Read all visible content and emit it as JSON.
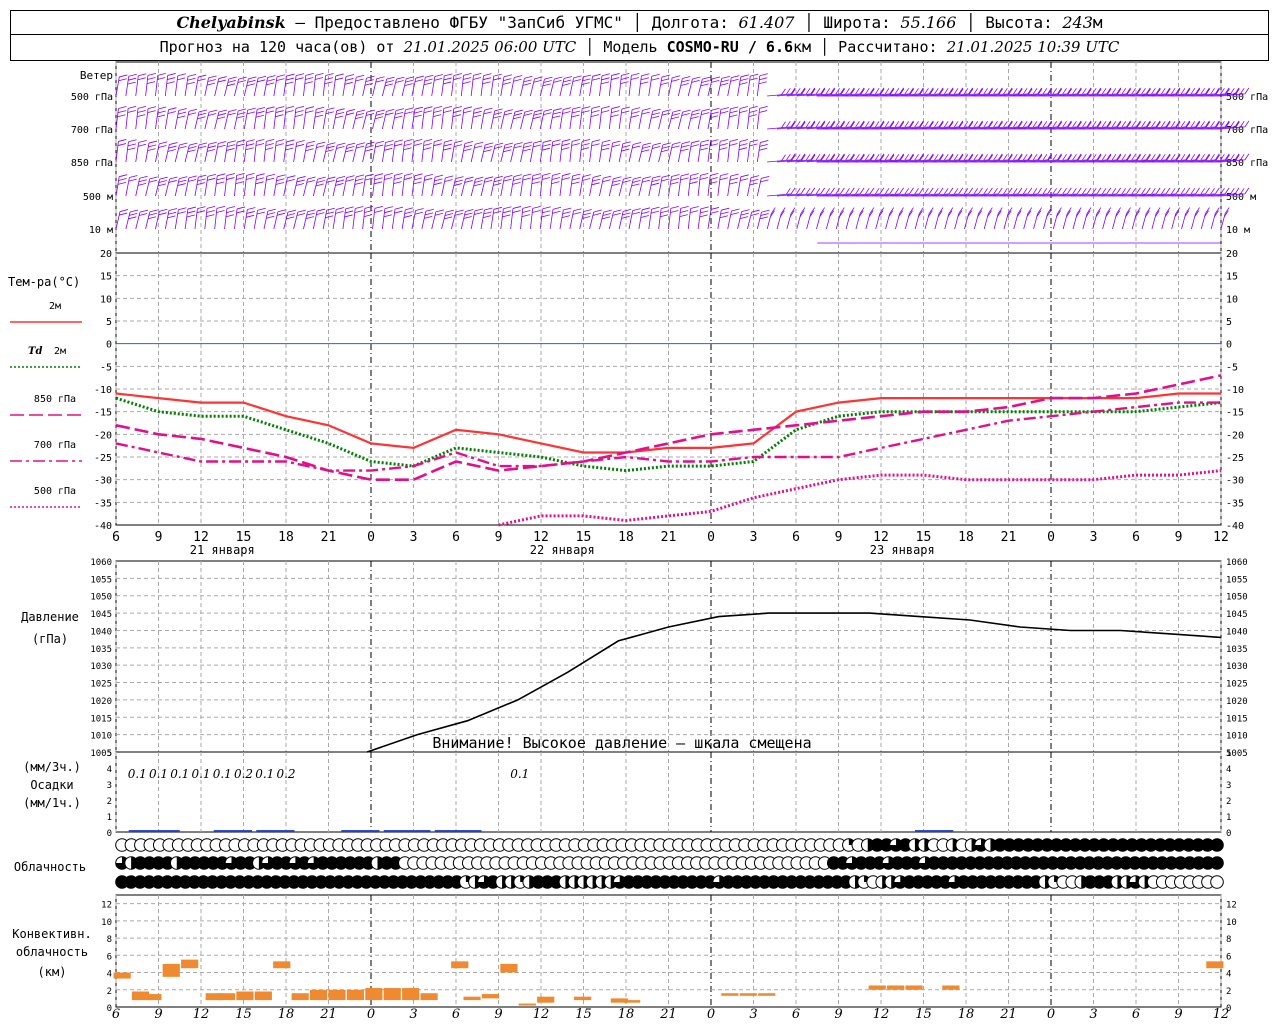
{
  "header": {
    "city": "Chelyabinsk",
    "provider": " – Предоставлено ФГБУ \"ЗапСиб УГМС\" │ Долгота: ",
    "lon": "61.407",
    "lat_label": " │ Широта: ",
    "lat": "55.166",
    "alt_label": " │ Высота: ",
    "alt": "243",
    "alt_unit": "м",
    "fc_label": "Прогноз на 120 часа(ов) от ",
    "fc_time": "21.01.2025 06:00 UTC",
    "model_label": " │ Модель ",
    "model": "COSMO-RU / 6.6",
    "model_unit": "км",
    "calc_label": " │ Рассчитано: ",
    "calc_time": "21.01.2025 10:39 UTC"
  },
  "chart_data": {
    "x_hours": [
      6,
      9,
      12,
      15,
      18,
      21,
      0,
      3,
      6,
      9,
      12,
      15,
      18,
      21,
      0,
      3,
      6,
      9,
      12,
      15,
      18,
      21,
      0,
      3,
      6,
      9,
      12
    ],
    "day_labels": [
      "21 января",
      "22 января",
      "23 января"
    ],
    "wind": {
      "title": "Ветер",
      "levels": [
        "500 гПа",
        "700 гПа",
        "850 гПа",
        "500 м",
        "10 м"
      ],
      "color": "#7f00ff"
    },
    "temperature": {
      "type": "line",
      "title": "Тем-ра(°C)",
      "ylim": [
        -40,
        20
      ],
      "yticks": [
        20,
        15,
        10,
        5,
        0,
        -5,
        -10,
        -15,
        -20,
        -25,
        -30,
        -35,
        -40
      ],
      "legend": [
        {
          "label": "2м",
          "color": "#ff3333",
          "style": "solid"
        },
        {
          "label": "Td",
          "label2": "2м",
          "color": "#008000",
          "style": "dotted"
        },
        {
          "label": "850 гПа",
          "color": "#e0108c",
          "style": "longdash"
        },
        {
          "label": "700 гПа",
          "color": "#e0108c",
          "style": "dashdot"
        },
        {
          "label": "500 гПа",
          "color": "#e0108c",
          "style": "dotted"
        }
      ],
      "series": [
        {
          "name": "2м",
          "values": [
            -11,
            -12,
            -13,
            -13,
            -16,
            -18,
            -22,
            -23,
            -19,
            -20,
            -22,
            -24,
            -24,
            -23,
            -23,
            -22,
            -15,
            -13,
            -12,
            -12,
            -12,
            -12,
            -12,
            -12,
            -12,
            -11,
            -11
          ]
        },
        {
          "name": "Td 2м",
          "values": [
            -12,
            -15,
            -16,
            -16,
            -19,
            -22,
            -26,
            -27,
            -23,
            -24,
            -25,
            -27,
            -28,
            -27,
            -27,
            -26,
            -19,
            -16,
            -15,
            -15,
            -15,
            -15,
            -15,
            -15,
            -15,
            -14,
            -13
          ]
        },
        {
          "name": "850 гПа",
          "values": [
            -18,
            -20,
            -21,
            -23,
            -25,
            -28,
            -30,
            -30,
            -26,
            -28,
            -27,
            -26,
            -24,
            -22,
            -20,
            -19,
            -18,
            -17,
            -16,
            -15,
            -15,
            -14,
            -12,
            -12,
            -11,
            -9,
            -7
          ]
        },
        {
          "name": "700 гПа",
          "values": [
            -22,
            -24,
            -26,
            -26,
            -26,
            -28,
            -28,
            -27,
            -24,
            -27,
            -27,
            -26,
            -25,
            -26,
            -26,
            -25,
            -25,
            -25,
            -23,
            -21,
            -19,
            -17,
            -16,
            -15,
            -14,
            -13,
            -13
          ]
        },
        {
          "name": "500 гПа",
          "values": [
            null,
            null,
            null,
            null,
            null,
            null,
            null,
            null,
            null,
            -40,
            -38,
            -38,
            -39,
            -38,
            -37,
            -34,
            -32,
            -30,
            -29,
            -29,
            -30,
            -30,
            -30,
            -30,
            -29,
            -29,
            -28
          ]
        }
      ]
    },
    "pressure": {
      "type": "line",
      "title": "Давление",
      "unit": "(гПа)",
      "ylim": [
        1005,
        1060
      ],
      "yticks": [
        1060,
        1055,
        1050,
        1045,
        1040,
        1035,
        1030,
        1025,
        1020,
        1015,
        1010,
        1005
      ],
      "warning": "Внимание! Высокое давление – шкала смещена",
      "color": "#000000",
      "values": [
        null,
        null,
        null,
        null,
        null,
        1005,
        1010,
        1014,
        1020,
        1028,
        1037,
        1041,
        1044,
        1045,
        1045,
        1045,
        1044,
        1043,
        1041,
        1040,
        1040,
        1039,
        1038
      ]
    },
    "precip": {
      "type": "bar",
      "label1": "(мм/3ч.)",
      "label2": "Осадки",
      "label3": "(мм/1ч.)",
      "ylim": [
        0,
        5
      ],
      "yticks": [
        5,
        4,
        3,
        2,
        1,
        0
      ],
      "values_labels": [
        "0.1",
        "0.1",
        "0.1",
        "0.1",
        "0.1",
        "0.2",
        "0.1",
        "0.2",
        "",
        "",
        "",
        "",
        "",
        "",
        "",
        "",
        "",
        "",
        "0.1"
      ],
      "color": "#1f40d0"
    },
    "clouds": {
      "title": "Облачность",
      "low": [
        0,
        0,
        0,
        0,
        0,
        0,
        0,
        0,
        0,
        0,
        0,
        0,
        0,
        0,
        0,
        0,
        0,
        0,
        0,
        0,
        0,
        0,
        0,
        0,
        0,
        0,
        0,
        0,
        0,
        0,
        0,
        0,
        0,
        0,
        0,
        0,
        0,
        0,
        0,
        0,
        0,
        0,
        0,
        0,
        0,
        0,
        0,
        0,
        0,
        0,
        0,
        0,
        0,
        0,
        0,
        0,
        0,
        0,
        0,
        0,
        0,
        0,
        0,
        0,
        0,
        0,
        0,
        0,
        0,
        0,
        0,
        0,
        0,
        0,
        0,
        0,
        0,
        0.25,
        0,
        0.5,
        1,
        1,
        0.75,
        1,
        0.5,
        0.5,
        0,
        0,
        0.5,
        0,
        0.5,
        0.75,
        0.5,
        1,
        1,
        1,
        1,
        1,
        1,
        1,
        1,
        1,
        1,
        1,
        1,
        1,
        1,
        1,
        1,
        1,
        1,
        1,
        1,
        1,
        1,
        1,
        1
      ],
      "mid": [
        0.75,
        0.5,
        1,
        1,
        1,
        1,
        0.5,
        1,
        1,
        1,
        1,
        1,
        0.75,
        1,
        1,
        0.5,
        0.75,
        1,
        1,
        0.75,
        1,
        0.75,
        1,
        1,
        1,
        1,
        1,
        1,
        0.5,
        1,
        1,
        0,
        0,
        0,
        0,
        0,
        0,
        0,
        0,
        0,
        0,
        0,
        0,
        0,
        0,
        0,
        0,
        0,
        0,
        0,
        0,
        0,
        0,
        0,
        0,
        0,
        0,
        0,
        0,
        0,
        0,
        0,
        0,
        0,
        0,
        0,
        0,
        0,
        0,
        0,
        0,
        0,
        0,
        0,
        0,
        0,
        0,
        0,
        1,
        1,
        0.75,
        1,
        1,
        1,
        0.75,
        1,
        1,
        1,
        0.75,
        1,
        1,
        1,
        1,
        1,
        1,
        1,
        1,
        1,
        1,
        1,
        1,
        1,
        1,
        1,
        1,
        1,
        1,
        1,
        1,
        1,
        1,
        1,
        1,
        1,
        1,
        1,
        1,
        1,
        1,
        1,
        1
      ],
      "high": [
        1,
        1,
        1,
        1,
        1,
        1,
        1,
        1,
        1,
        1,
        1,
        1,
        1,
        1,
        1,
        1,
        1,
        1,
        1,
        1,
        1,
        1,
        1,
        1,
        1,
        1,
        1,
        1,
        1,
        1,
        1,
        1,
        1,
        1,
        1,
        1,
        1,
        1,
        0.25,
        0.5,
        0.75,
        1,
        0.5,
        0.5,
        0.25,
        0.5,
        1,
        1,
        1,
        0.5,
        0.5,
        0.5,
        0.5,
        0.5,
        0.5,
        0.75,
        1,
        1,
        1,
        1,
        1,
        1,
        1,
        1,
        1,
        1,
        0.75,
        1,
        1,
        1,
        1,
        1,
        1,
        1,
        1,
        1,
        1,
        1,
        1,
        1,
        1,
        0.5,
        0.25,
        0,
        0.5,
        0.5,
        0.75,
        1,
        1,
        1,
        1,
        1,
        0.75,
        1,
        1,
        1,
        1,
        1,
        1,
        1,
        1,
        1,
        0.5,
        0.25,
        0,
        0,
        0.5,
        1,
        1,
        1,
        0.5,
        0.5,
        0.75,
        0.5,
        0,
        0,
        0,
        0,
        0,
        0,
        0,
        0
      ]
    },
    "convective": {
      "type": "bar",
      "title1": "Конвективн.",
      "title2": "облачность",
      "unit": "(км)",
      "ylim": [
        0,
        13
      ],
      "yticks": [
        12,
        10,
        8,
        6,
        4,
        2,
        0
      ],
      "color": "#f08a30",
      "segments": [
        {
          "x": 0.5,
          "y0": 3.3,
          "y1": 4.0
        },
        {
          "x": 2,
          "y0": 0.8,
          "y1": 1.8
        },
        {
          "x": 3,
          "y0": 0.8,
          "y1": 1.5
        },
        {
          "x": 4.5,
          "y0": 3.5,
          "y1": 5.0
        },
        {
          "x": 6,
          "y0": 4.5,
          "y1": 5.5
        },
        {
          "x": 8,
          "y0": 0.8,
          "y1": 1.6
        },
        {
          "x": 9,
          "y0": 0.8,
          "y1": 1.6
        },
        {
          "x": 10.5,
          "y0": 0.8,
          "y1": 1.8
        },
        {
          "x": 12,
          "y0": 0.8,
          "y1": 1.8
        },
        {
          "x": 13.5,
          "y0": 4.5,
          "y1": 5.3
        },
        {
          "x": 15,
          "y0": 0.8,
          "y1": 1.6
        },
        {
          "x": 16.5,
          "y0": 0.8,
          "y1": 2.0
        },
        {
          "x": 18,
          "y0": 0.8,
          "y1": 2.0
        },
        {
          "x": 19.5,
          "y0": 0.8,
          "y1": 2.0
        },
        {
          "x": 21,
          "y0": 0.8,
          "y1": 2.2
        },
        {
          "x": 22.5,
          "y0": 0.8,
          "y1": 2.2
        },
        {
          "x": 24,
          "y0": 0.8,
          "y1": 2.2
        },
        {
          "x": 25.5,
          "y0": 0.8,
          "y1": 1.6
        },
        {
          "x": 28,
          "y0": 4.5,
          "y1": 5.3
        },
        {
          "x": 29,
          "y0": 0.8,
          "y1": 1.2
        },
        {
          "x": 30.5,
          "y0": 1.0,
          "y1": 1.5
        },
        {
          "x": 32,
          "y0": 4.0,
          "y1": 5.0
        },
        {
          "x": 33.5,
          "y0": 0.2,
          "y1": 0.4
        },
        {
          "x": 35,
          "y0": 0.5,
          "y1": 1.2
        },
        {
          "x": 38,
          "y0": 0.8,
          "y1": 1.2
        },
        {
          "x": 41,
          "y0": 0.5,
          "y1": 1.0
        },
        {
          "x": 42,
          "y0": 0.5,
          "y1": 0.8
        },
        {
          "x": 50,
          "y0": 1.3,
          "y1": 1.6
        },
        {
          "x": 51.5,
          "y0": 1.3,
          "y1": 1.6
        },
        {
          "x": 53,
          "y0": 1.3,
          "y1": 1.6
        },
        {
          "x": 62,
          "y0": 2.0,
          "y1": 2.5
        },
        {
          "x": 63.5,
          "y0": 2.0,
          "y1": 2.5
        },
        {
          "x": 65,
          "y0": 2.0,
          "y1": 2.5
        },
        {
          "x": 68,
          "y0": 2.0,
          "y1": 2.5
        },
        {
          "x": 89.5,
          "y0": 4.5,
          "y1": 5.3
        }
      ]
    }
  }
}
